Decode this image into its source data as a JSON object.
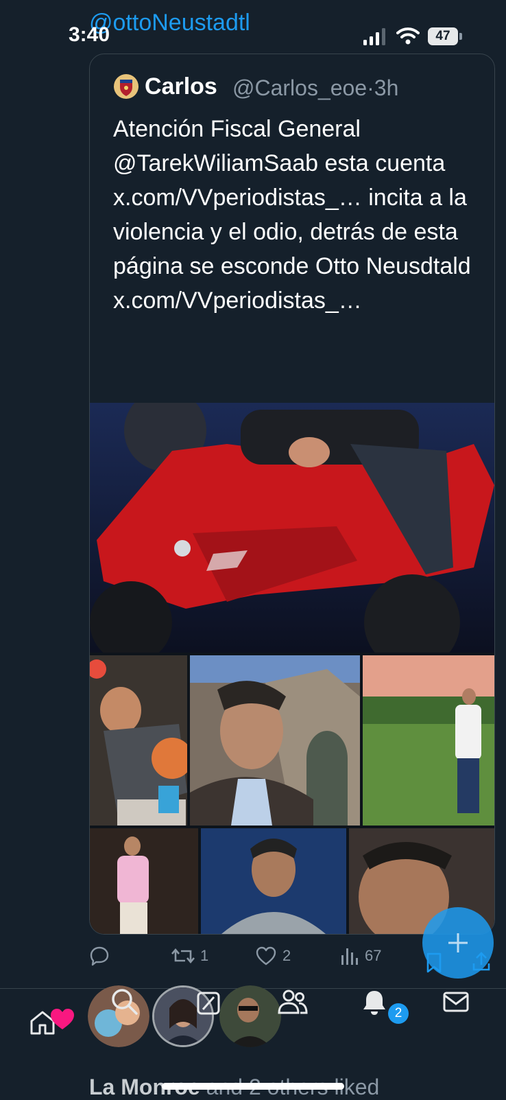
{
  "status_bar": {
    "time": "3:40",
    "battery": "47",
    "behind_text": "@ottoNeustadtl"
  },
  "quote_tweet": {
    "name": "Carlos",
    "handle": "@Carlos_eoe",
    "time": "·3h",
    "text": "Atención Fiscal General @TarekWiliamSaab esta cuenta x.com/VVperiodistas_… incita a la violencia y el odio, detrás de esta página se esconde Otto Neusdtald x.com/VVperiodistas_…"
  },
  "actions": {
    "retweets": "1",
    "likes": "2",
    "views": "67"
  },
  "notifications": {
    "badge": "2"
  },
  "bottom": {
    "liked_name": "La Monroe",
    "liked_rest": "and 2 others liked"
  },
  "colors": {
    "background": "#15202b",
    "accent": "#1d9bf0",
    "secondary_text": "#8b98a5",
    "border": "#38444d",
    "heart": "#f91880"
  },
  "icons": [
    "reply-icon",
    "retweet-icon",
    "like-icon",
    "views-icon",
    "bookmark-icon",
    "share-icon",
    "plus-icon",
    "home-icon",
    "search-icon",
    "grok-icon",
    "communities-icon",
    "bell-icon",
    "mail-icon"
  ]
}
